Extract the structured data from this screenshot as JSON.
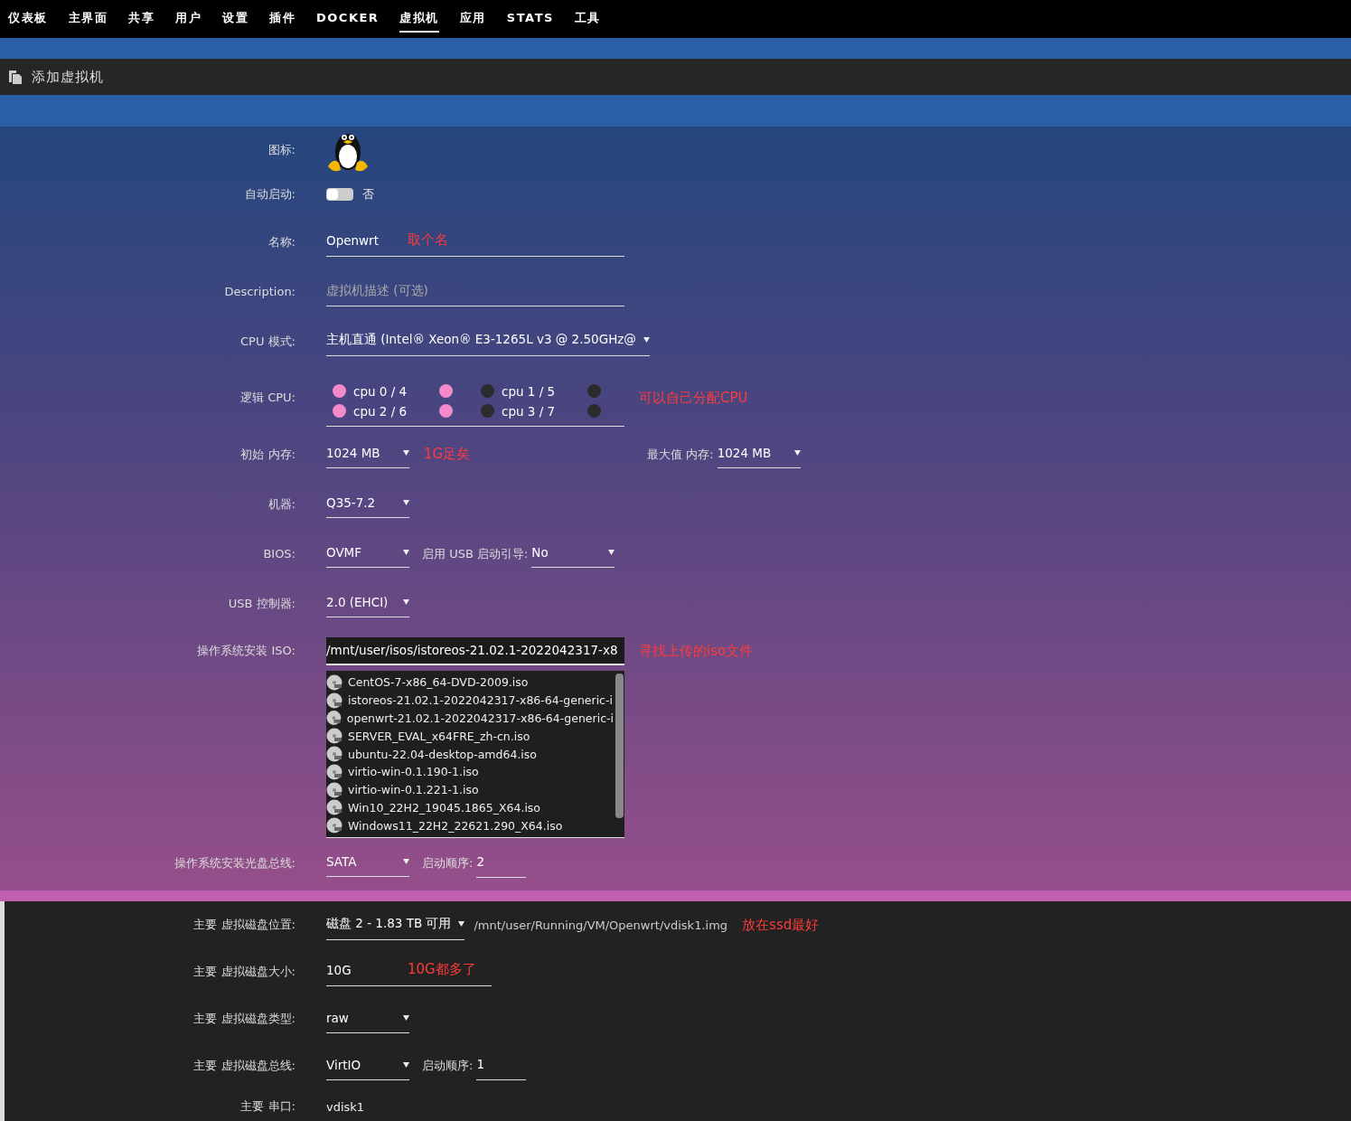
{
  "nav": {
    "tabs": [
      {
        "label": "仪表板",
        "selected": false
      },
      {
        "label": "主界面",
        "selected": false
      },
      {
        "label": "共享",
        "selected": false
      },
      {
        "label": "用户",
        "selected": false
      },
      {
        "label": "设置",
        "selected": false
      },
      {
        "label": "插件",
        "selected": false
      },
      {
        "label": "DOCKER",
        "selected": false
      },
      {
        "label": "虚拟机",
        "selected": true
      },
      {
        "label": "应用",
        "selected": false
      },
      {
        "label": "STATS",
        "selected": false
      },
      {
        "label": "工具",
        "selected": false
      }
    ]
  },
  "title_bar": {
    "title": "添加虚拟机"
  },
  "form": {
    "sections": [
      {
        "rows": [
          {
            "label": "图标:",
            "kind": "icon"
          },
          {
            "label": "自动启动:",
            "kind": "toggle",
            "on": false,
            "state_label": "否"
          },
          {
            "label": "名称:",
            "kind": "input",
            "value": "Openwrt",
            "note": "取个名"
          },
          {
            "label": "Description:",
            "kind": "input",
            "placeholder": "虚拟机描述 (可选)"
          },
          {
            "label": "CPU 模式:",
            "kind": "select",
            "value": "主机直通 (Intel® Xeon® E3-1265L v3 @ 2.50GHz@"
          },
          {
            "label": "逻辑 CPU:",
            "kind": "cpus",
            "note": "可以自己分配CPU",
            "cpus": [
              {
                "label": "cpu 0 / 4",
                "threads": [
                  {
                    "checked": true
                  },
                  {
                    "checked": true
                  }
                ]
              },
              {
                "label": "cpu 1 / 5",
                "threads": [
                  {
                    "checked": false
                  },
                  {
                    "checked": false
                  }
                ]
              },
              {
                "label": "cpu 2 / 6",
                "threads": [
                  {
                    "checked": true
                  },
                  {
                    "checked": true
                  }
                ]
              },
              {
                "label": "cpu 3 / 7",
                "threads": [
                  {
                    "checked": false
                  },
                  {
                    "checked": false
                  }
                ]
              }
            ]
          },
          {
            "label": "初始 内存:",
            "kind": "select",
            "value": "1024 MB",
            "note": "1G足矣",
            "secondary": {
              "kind": "select",
              "label": "最大值 内存:",
              "value": "1024 MB"
            }
          },
          {
            "label": "机器:",
            "kind": "select",
            "value": "Q35-7.2"
          },
          {
            "label": "BIOS:",
            "kind": "select",
            "value": "OVMF",
            "secondary": {
              "kind": "select",
              "label": "启用 USB 启动引导:",
              "value": "No"
            }
          },
          {
            "label": "USB 控制器:",
            "kind": "select",
            "value": "2.0 (EHCI)"
          },
          {
            "label": "操作系统安装 ISO:",
            "kind": "iso",
            "value": "/mnt/user/isos/istoreos-21.02.1-2022042317-x8",
            "note": "寻找上传的iso文件",
            "files": [
              "CentOS-7-x86_64-DVD-2009.iso",
              "istoreos-21.02.1-2022042317-x86-64-generic-i",
              "openwrt-21.02.1-2022042317-x86-64-generic-i",
              "SERVER_EVAL_x64FRE_zh-cn.iso",
              "ubuntu-22.04-desktop-amd64.iso",
              "virtio-win-0.1.190-1.iso",
              "virtio-win-0.1.221-1.iso",
              "Win10_22H2_19045.1865_X64.iso",
              "Windows11_22H2_22621.290_X64.iso"
            ]
          },
          {
            "label": "操作系统安装光盘总线:",
            "kind": "select",
            "value": "SATA",
            "secondary": {
              "kind": "input",
              "label": "启动顺序:",
              "value": "2"
            }
          }
        ]
      },
      {
        "rows": [
          {
            "label": "主要 虚拟磁盘位置:",
            "kind": "select",
            "value": "磁盘 2 - 1.83 TB 可用",
            "path": "/mnt/user/Running/VM/Openwrt/vdisk1.img",
            "note": "放在ssd最好"
          },
          {
            "label": "主要 虚拟磁盘大小:",
            "kind": "input",
            "value": "10G",
            "note": "10G都多了"
          },
          {
            "label": "主要 虚拟磁盘类型:",
            "kind": "select",
            "value": "raw"
          },
          {
            "label": "主要 虚拟磁盘总线:",
            "kind": "select",
            "value": "VirtIO",
            "secondary": {
              "kind": "input",
              "label": "启动顺序:",
              "value": "1"
            }
          },
          {
            "label": "主要 串口:",
            "kind": "text",
            "value": "vdisk1"
          }
        ]
      }
    ]
  }
}
